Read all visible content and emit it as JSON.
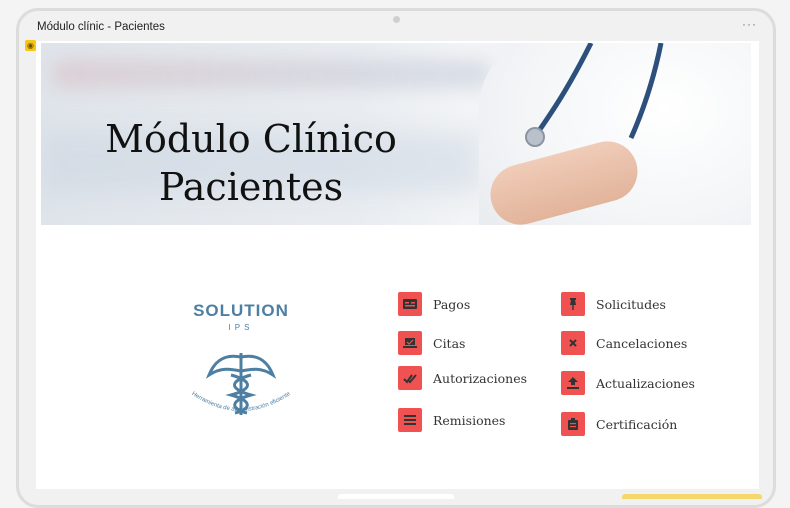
{
  "window": {
    "title": "Módulo clínic - Pacientes",
    "more_label": "···"
  },
  "banner": {
    "line1": "Módulo Clínico",
    "line2": "Pacientes"
  },
  "logo": {
    "name": "SOLUTION",
    "sub": "IPS",
    "tagline": "Herramienta de administración eficiente"
  },
  "menu_left": [
    {
      "label": "Pagos",
      "icon": "payment-icon"
    },
    {
      "label": "Citas",
      "icon": "laptop-icon"
    },
    {
      "label": "Autorizaciones",
      "icon": "double-check-icon"
    },
    {
      "label": "Remisiones",
      "icon": "list-icon"
    }
  ],
  "menu_right": [
    {
      "label": "Solicitudes",
      "icon": "pin-icon"
    },
    {
      "label": "Cancelaciones",
      "icon": "close-icon"
    },
    {
      "label": "Actualizaciones",
      "icon": "upload-icon"
    },
    {
      "label": "Certificación",
      "icon": "clipboard-icon"
    }
  ],
  "colors": {
    "icon_bg": "#f05252",
    "logo": "#4d7fa3",
    "badge": "#f5c518"
  }
}
